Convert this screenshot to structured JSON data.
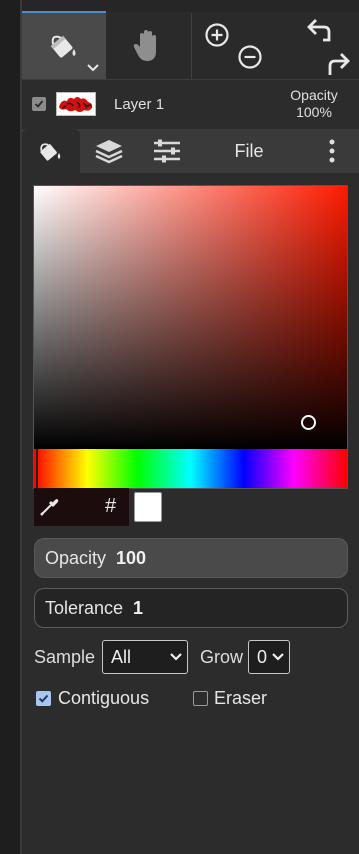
{
  "toolbar": {
    "tools": [
      {
        "name": "fill",
        "icon": "paint-bucket-icon",
        "active": true
      },
      {
        "name": "hand",
        "icon": "hand-icon"
      }
    ],
    "zoom_in_icon": "zoom-in-icon",
    "zoom_out_icon": "zoom-out-icon",
    "undo_icon": "undo-icon",
    "redo_icon": "redo-icon",
    "accent_color": "#4f8ac9"
  },
  "layer": {
    "name": "Layer 1",
    "visible": true,
    "opacity_label": "Opacity",
    "opacity_value": "100%"
  },
  "tabs": [
    {
      "icon": "paint-bucket-icon",
      "active": true
    },
    {
      "icon": "layers-icon"
    },
    {
      "icon": "sliders-icon"
    },
    {
      "label": "File"
    },
    {
      "icon": "more-vertical-icon"
    }
  ],
  "color_picker": {
    "hue_color": "#ff1a00",
    "selected_color": "#ffffff",
    "hash_label": "#",
    "eyedropper_icon": "eyedropper-icon"
  },
  "fields": {
    "opacity_label": "Opacity",
    "opacity_value": "100",
    "tolerance_label": "Tolerance",
    "tolerance_value": "1"
  },
  "options": {
    "sample_label": "Sample",
    "sample_value": "All",
    "grow_label": "Grow",
    "grow_value": "0",
    "contiguous_label": "Contiguous",
    "contiguous_checked": true,
    "eraser_label": "Eraser",
    "eraser_checked": false
  }
}
